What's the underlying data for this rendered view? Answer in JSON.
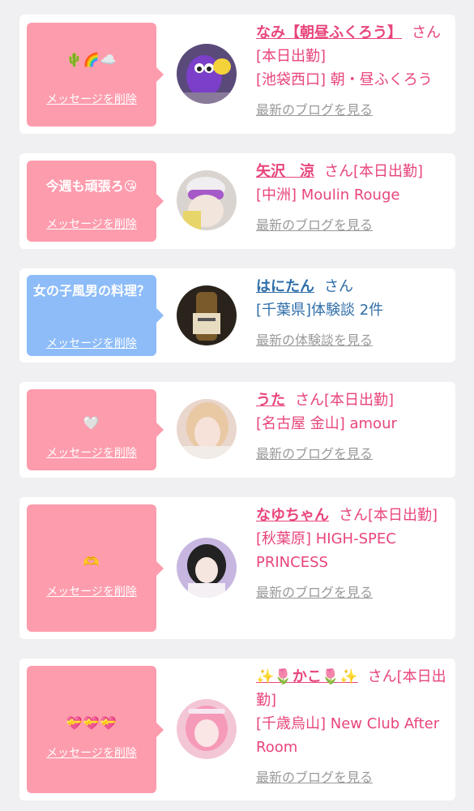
{
  "colors": {
    "pink": "#fd9cad",
    "blue": "#8dbcf8",
    "name_pink": "#e8457a",
    "name_blue": "#2f6ea8",
    "link_gray": "#999999"
  },
  "delete_label": "メッセージを削除",
  "cards": [
    {
      "message": "🌵🌈☁️",
      "name": "なみ【朝昼ふくろう】",
      "san": "さん",
      "status": "[本日出勤]",
      "shop": "[池袋西口] 朝・昼ふくろう",
      "link": "最新のブログを見る"
    },
    {
      "message": "今週も頑張ろ😘",
      "name": "矢沢　涼",
      "san": "さん",
      "status": "[本日出勤]",
      "shop": "[中洲] Moulin Rouge",
      "link": "最新のブログを見る"
    },
    {
      "message": "女の子風男の料理？",
      "name": "はにたん",
      "san": "さん",
      "status": "",
      "shop": "[千葉県]体験談 2件",
      "link": "最新の体験談を見る"
    },
    {
      "message": "🤍",
      "name": "うた",
      "san": "さん",
      "status": "[本日出勤]",
      "shop": "[名古屋 金山] amour",
      "link": "最新のブログを見る"
    },
    {
      "message": "🫶",
      "name": "なゆちゃん",
      "san": "さん",
      "status": "[本日出勤]",
      "shop": "[秋葉原] HIGH-SPEC PRINCESS",
      "link": "最新のブログを見る"
    },
    {
      "message": "💝💝💝",
      "name": "✨🌷かこ🌷✨",
      "san": "さん",
      "status": "[本日出勤]",
      "shop": "[千歳烏山] New Club After Room",
      "link": "最新のブログを見る"
    }
  ]
}
